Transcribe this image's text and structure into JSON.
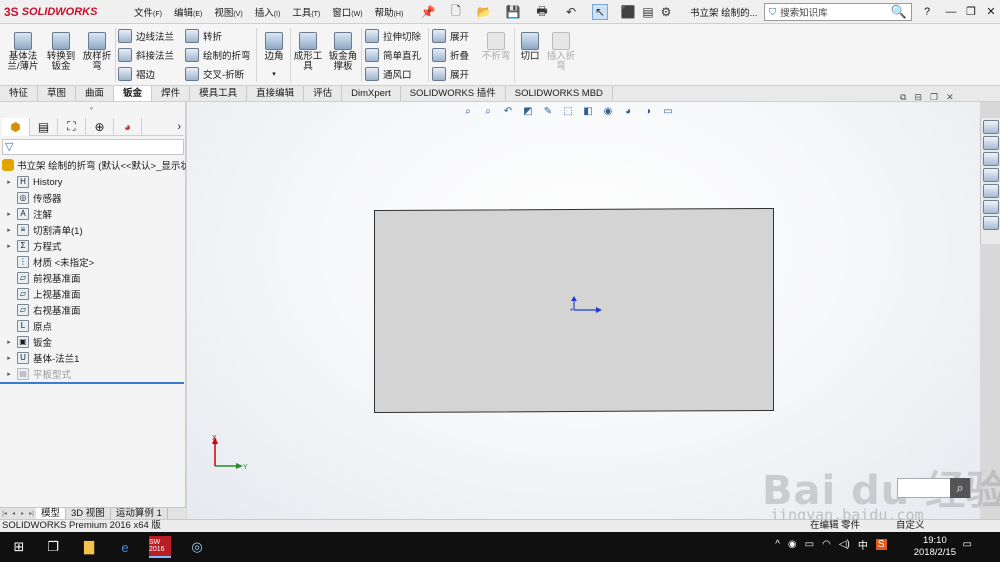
{
  "app": {
    "logo_ds": "3S",
    "logo_text": "SOLIDWORKS",
    "doc_title": "书立架 绘制的..."
  },
  "menu": [
    {
      "label": "文件",
      "key": "(F)"
    },
    {
      "label": "编辑",
      "key": "(E)"
    },
    {
      "label": "视图",
      "key": "(V)"
    },
    {
      "label": "插入",
      "key": "(I)"
    },
    {
      "label": "工具",
      "key": "(T)"
    },
    {
      "label": "窗口",
      "key": "(W)"
    },
    {
      "label": "帮助",
      "key": "(H)"
    }
  ],
  "search": {
    "placeholder": "搜索知识库",
    "mag": "🔍"
  },
  "window_buttons": {
    "help": "?",
    "minimize": "—",
    "restore": "❐",
    "close": "✕"
  },
  "ribbon": {
    "base_flange": "基体法\n兰/薄片",
    "convert": "转换到\n钣金",
    "lofted_bend": "放样折\n弯",
    "edge_flange": "边线法兰",
    "miter_flange": "斜接法兰",
    "hem": "褶边",
    "jog": "转折",
    "sketched_bend": "绘制的折弯",
    "cross_break": "交叉-折断",
    "corners": "边角",
    "forming_tool": "成形工\n具",
    "gusset": "钣金角\n撑板",
    "extruded_cut": "拉伸切除",
    "simple_hole": "简单直孔",
    "vent": "通风口",
    "unfold": "展开",
    "fold": "折叠",
    "flatten": "展开",
    "no_bends": "不折弯",
    "rip": "切口",
    "insert_bends": "插入折\n弯"
  },
  "tabs": [
    "特征",
    "草图",
    "曲面",
    "钣金",
    "焊件",
    "模具工具",
    "直接编辑",
    "评估",
    "DimXpert",
    "SOLIDWORKS 插件",
    "SOLIDWORKS MBD"
  ],
  "active_tab": "钣金",
  "tree": {
    "root": "书立架 绘制的折弯 (默认<<默认>_显示状",
    "items": [
      {
        "label": "History",
        "expand": "▸",
        "icon": "H"
      },
      {
        "label": "传感器",
        "expand": "",
        "icon": "◎"
      },
      {
        "label": "注解",
        "expand": "▸",
        "icon": "A"
      },
      {
        "label": "切割清单(1)",
        "expand": "▸",
        "icon": "≡"
      },
      {
        "label": "方程式",
        "expand": "▸",
        "icon": "Σ"
      },
      {
        "label": "材质 <未指定>",
        "expand": "",
        "icon": "⋮"
      },
      {
        "label": "前视基准面",
        "expand": "",
        "icon": "▱"
      },
      {
        "label": "上视基准面",
        "expand": "",
        "icon": "▱"
      },
      {
        "label": "右视基准面",
        "expand": "",
        "icon": "▱"
      },
      {
        "label": "原点",
        "expand": "",
        "icon": "L"
      },
      {
        "label": "钣金",
        "expand": "▸",
        "icon": "▣"
      },
      {
        "label": "基体-法兰1",
        "expand": "▸",
        "icon": "U"
      },
      {
        "label": "平板型式",
        "expand": "▸",
        "icon": "▤"
      }
    ]
  },
  "bottom_tabs": [
    "模型",
    "3D 视图",
    "运动算例 1"
  ],
  "status": {
    "left": "SOLIDWORKS Premium 2016 x64 版",
    "r1": "在编辑 零件",
    "r2": "自定义"
  },
  "taskbar": {
    "time": "19:10",
    "date": "2018/2/15",
    "ime": "中",
    "sw_label": "SW 2016"
  },
  "watermark": {
    "main": "Bai du 经验",
    "sub": "jingyan.baidu.com"
  },
  "triad": {
    "x": "Y",
    "y": "X"
  }
}
